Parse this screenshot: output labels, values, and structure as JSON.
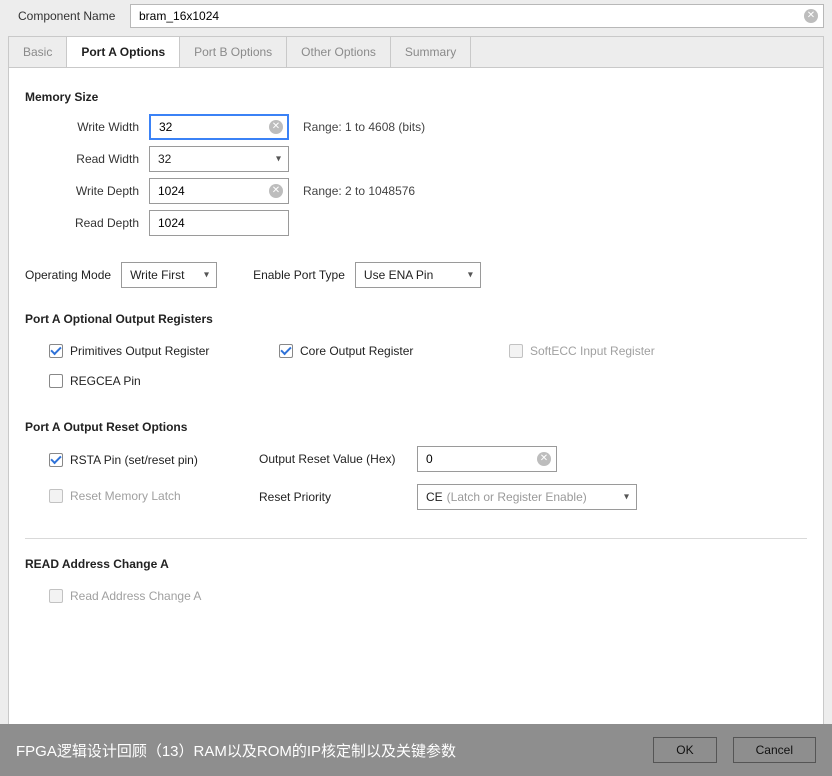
{
  "componentName": {
    "label": "Component Name",
    "value": "bram_16x1024"
  },
  "tabs": [
    "Basic",
    "Port A Options",
    "Port B Options",
    "Other Options",
    "Summary"
  ],
  "activeTabIndex": 1,
  "memorySize": {
    "title": "Memory Size",
    "writeWidth": {
      "label": "Write Width",
      "value": "32",
      "range": "Range: 1 to 4608 (bits)"
    },
    "readWidth": {
      "label": "Read Width",
      "value": "32"
    },
    "writeDepth": {
      "label": "Write Depth",
      "value": "1024",
      "range": "Range: 2 to 1048576"
    },
    "readDepth": {
      "label": "Read Depth",
      "value": "1024"
    }
  },
  "operating": {
    "modeLabel": "Operating Mode",
    "modeValue": "Write First",
    "enableLabel": "Enable Port Type",
    "enableValue": "Use ENA Pin"
  },
  "optionalRegisters": {
    "title": "Port A Optional Output Registers",
    "primitives": {
      "label": "Primitives Output Register",
      "checked": true,
      "disabled": false
    },
    "core": {
      "label": "Core Output Register",
      "checked": true,
      "disabled": false
    },
    "softecc": {
      "label": "SoftECC Input Register",
      "checked": false,
      "disabled": true
    },
    "regcea": {
      "label": "REGCEA Pin",
      "checked": false,
      "disabled": false
    }
  },
  "resetOptions": {
    "title": "Port A Output Reset Options",
    "rsta": {
      "label": "RSTA Pin (set/reset pin)",
      "checked": true,
      "disabled": false
    },
    "orvLabel": "Output Reset Value (Hex)",
    "orvValue": "0",
    "rml": {
      "label": "Reset Memory Latch",
      "checked": false,
      "disabled": true
    },
    "priorityLabel": "Reset Priority",
    "priorityValue": "CE",
    "priorityHint": "(Latch or Register Enable)"
  },
  "readAddr": {
    "title": "READ Address Change A",
    "cb": {
      "label": "Read Address Change A",
      "checked": false,
      "disabled": true
    }
  },
  "footer": {
    "message": "FPGA逻辑设计回顾（13）RAM以及ROM的IP核定制以及关键参数",
    "ok": "OK",
    "cancel": "Cancel"
  }
}
